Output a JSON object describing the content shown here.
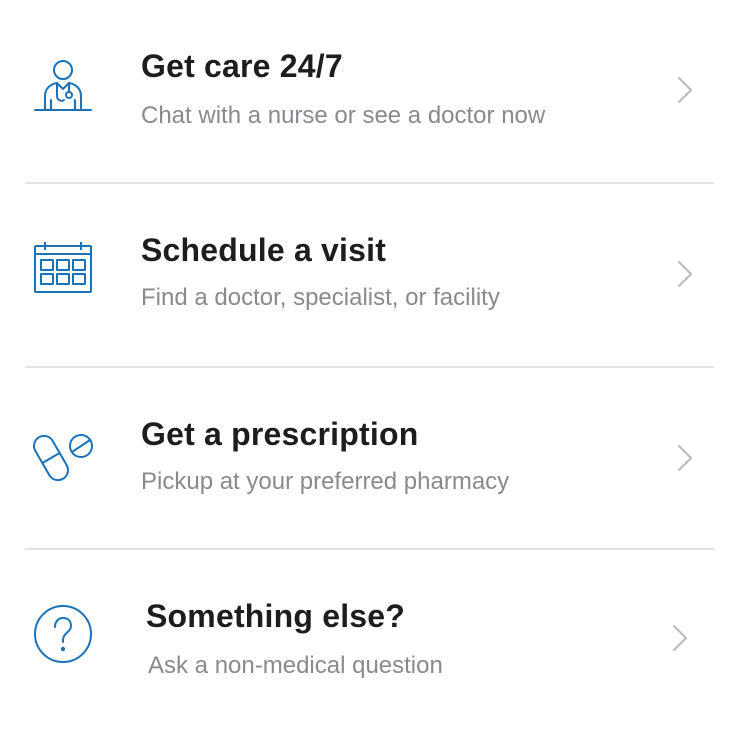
{
  "colors": {
    "icon": "#1a73b8",
    "title": "#1d1d1f",
    "subtitle": "#8a8a8e",
    "chevron": "#b8b8bd",
    "divider": "#e3e3e6"
  },
  "items": [
    {
      "title": "Get care 24/7",
      "subtitle": "Chat with a nurse or see a doctor now",
      "icon": "doctor-icon"
    },
    {
      "title": "Schedule a visit",
      "subtitle": "Find a doctor, specialist, or facility",
      "icon": "calendar-icon"
    },
    {
      "title": "Get a prescription",
      "subtitle": "Pickup at your preferred pharmacy",
      "icon": "pills-icon"
    },
    {
      "title": "Something else?",
      "subtitle": "Ask a non-medical question",
      "icon": "question-icon"
    }
  ]
}
